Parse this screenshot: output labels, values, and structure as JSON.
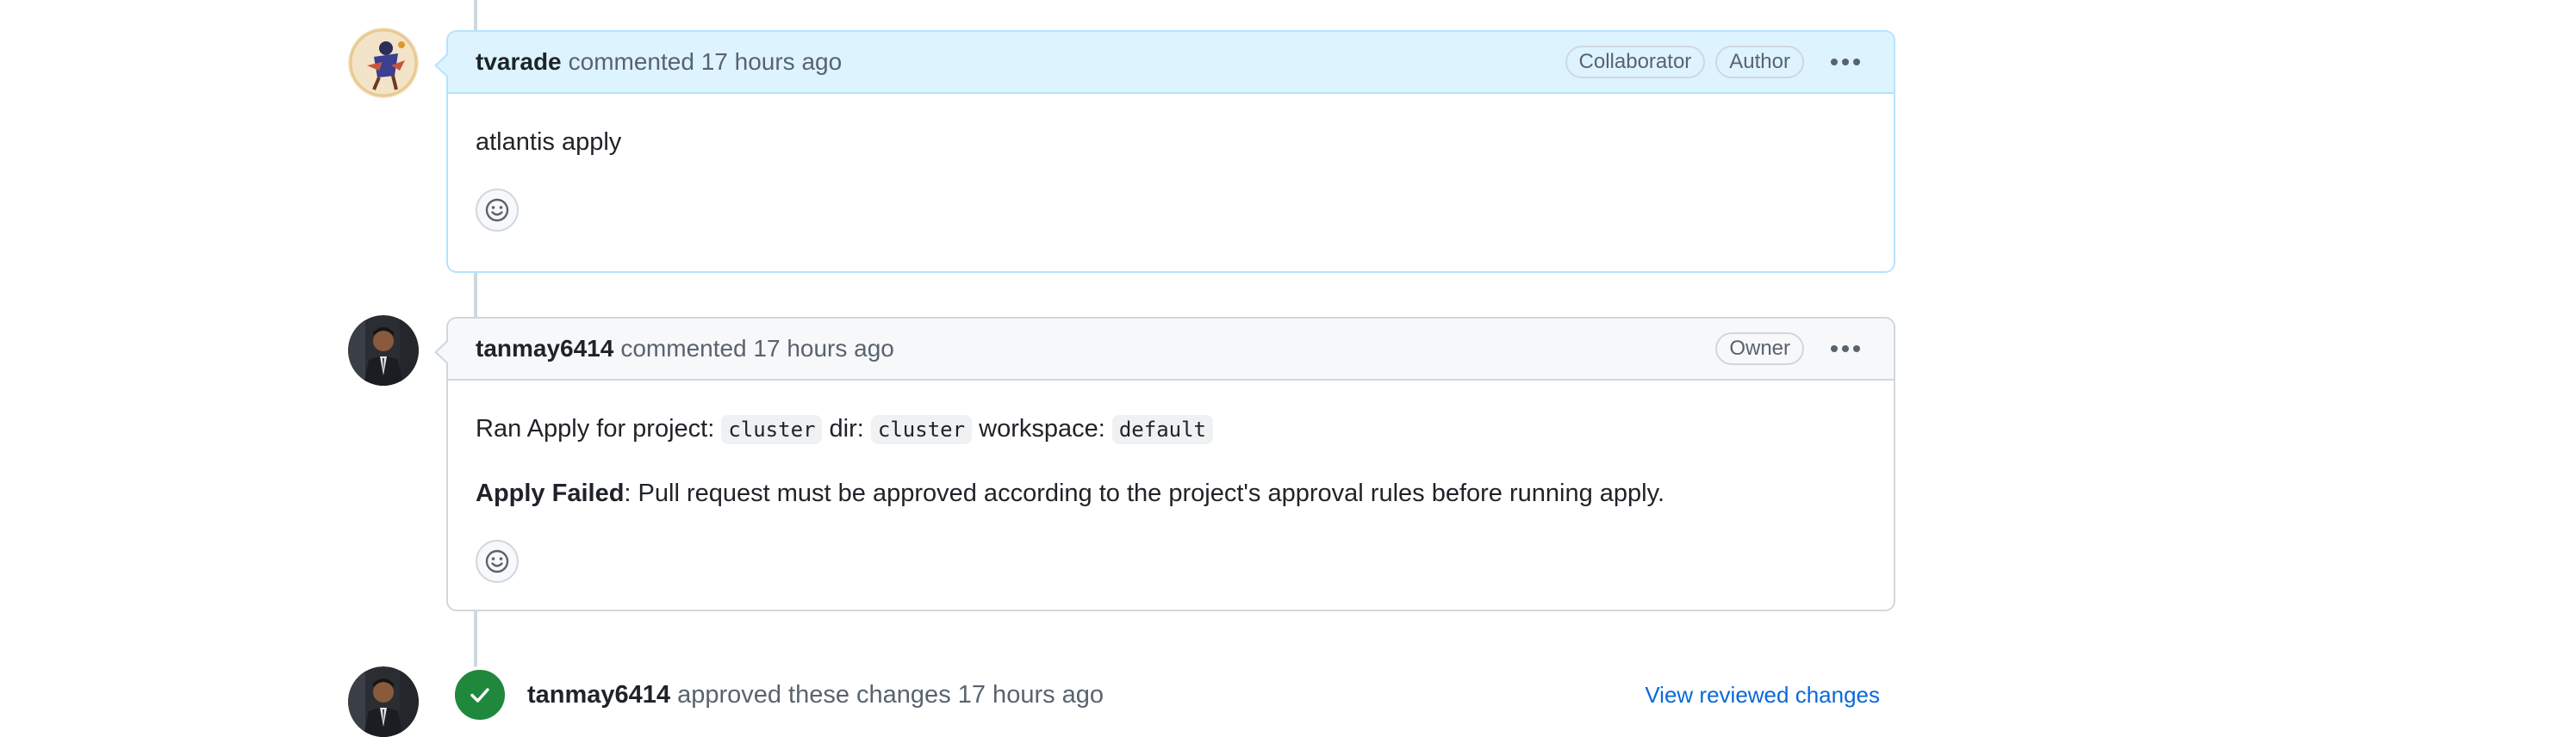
{
  "comments": [
    {
      "author": "tvarade",
      "meta": "commented 17 hours ago",
      "badges": [
        "Collaborator",
        "Author"
      ],
      "body_text": "atlantis apply"
    },
    {
      "author": "tanmay6414",
      "meta": "commented 17 hours ago",
      "badges": [
        "Owner"
      ],
      "line1": {
        "t1": "Ran Apply for project:",
        "c1": "cluster",
        "t2": "dir:",
        "c2": "cluster",
        "t3": "workspace:",
        "c3": "default"
      },
      "line2": {
        "bold": "Apply Failed",
        "rest": ": Pull request must be approved according to the project's approval rules before running apply."
      }
    }
  ],
  "review": {
    "author": "tanmay6414",
    "meta": "approved these changes 17 hours ago",
    "link": "View reviewed changes"
  },
  "colors": {
    "accent_link": "#0969da",
    "approve_green": "#1f883d",
    "author_header_bg": "#ddf4ff",
    "header_bg": "#f6f8fa"
  },
  "icons": {
    "reaction": "smiley-icon",
    "menu": "kebab-horizontal-icon",
    "approved": "check-icon"
  }
}
